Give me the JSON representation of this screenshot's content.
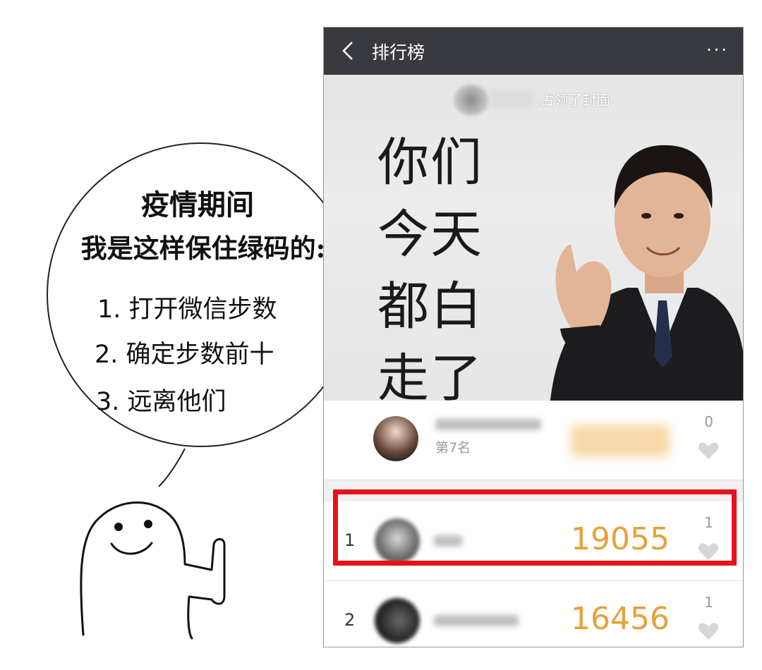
{
  "bubble": {
    "title_line1": "疫情期间",
    "title_line2": "我是这样保住绿码的:",
    "steps": [
      "1. 打开微信步数",
      "2. 确定步数前十",
      "3. 远离他们"
    ]
  },
  "header": {
    "back_icon": "chevron-left-icon",
    "title": "排行榜",
    "more_icon": "more-dots-icon",
    "more_text": "···"
  },
  "cover": {
    "caption": ",占领了封面",
    "big_text": "你们\n今天\n都白\n走了"
  },
  "my_entry": {
    "rank_label": "第7名",
    "likes": "0"
  },
  "rankings": [
    {
      "rank": "1",
      "steps": "19055",
      "likes": "1"
    },
    {
      "rank": "2",
      "steps": "16456",
      "likes": "1"
    }
  ],
  "colors": {
    "topbar": "#393a3f",
    "steps": "#e6a13a",
    "highlight": "#e8111a"
  }
}
